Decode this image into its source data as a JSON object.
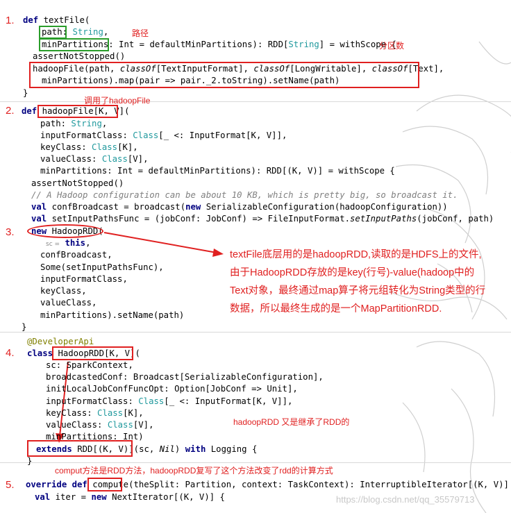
{
  "colors": {
    "red": "#e02020",
    "green": "#2a9d2a",
    "keyword": "#000080",
    "type": "#20999d",
    "comment": "#808080",
    "annotation": "#808000"
  },
  "numbers": [
    "1.",
    "2.",
    "3.",
    "4.",
    "5."
  ],
  "notes": {
    "path_label": "路径",
    "partition_label": "分区数",
    "calls_hadoopfile": "调用了hadoopFile",
    "explanation": [
      "textFile底层用的是hadoopRDD,读取的是HDFS上的文件,",
      "由于HadoopRDD存放的是key(行号)-value(hadoop中的",
      "Text对象，最终通过map算子将元组转化为String类型的行",
      "数据，所以最终生成的是一个MapPartitionRDD."
    ],
    "inherits": "hadoopRDD 又是继承了RDD的",
    "compute_note": "comput方法是RDD方法，hadoopRDD复写了这个方法改变了rdd的计算方式"
  },
  "code": {
    "s1": {
      "def": "def",
      "fn": "textFile(",
      "p_path": "path:",
      "t_string": "String",
      "p_minp": "minPartitions:",
      "l2rest_a": " Int = defaultMinPartitions): RDD[",
      "t_string2": "String",
      "l2rest_b": "] = withScope {",
      "l3": "assertNotStopped()",
      "l4a": "hadoopFile(path, ",
      "l4co": "classOf",
      "l4b": "[TextInputFormat], ",
      "l4co2": "classOf",
      "l4c": "[LongWritable], ",
      "l4co3": "classOf",
      "l4d": "[Text],",
      "l5": "minPartitions).map(pair => pair._2.toString).setName(path)",
      "close": "}"
    },
    "s2": {
      "def": "def",
      "sig": "hadoopFile[K, V]",
      "paren": "(",
      "l1a": "path: ",
      "l1t": "String",
      "l1b": ",",
      "l2a": "inputFormatClass: ",
      "l2t": "Class",
      "l2b": "[_ <: InputFormat[K, V]],",
      "l3a": "keyClass: ",
      "l3t": "Class",
      "l3b": "[K],",
      "l4a": "valueClass: ",
      "l4t": "Class",
      "l4b": "[V],",
      "l5": "minPartitions: Int = defaultMinPartitions): RDD[(K, V)] = withScope {",
      "l6": "assertNotStopped()",
      "comment": "// A Hadoop configuration can be about 10 KB, which is pretty big, so broadcast it.",
      "l8kw": "val",
      "l8a": " confBroadcast = broadcast(",
      "l8kw2": "new",
      "l8b": " SerializableConfiguration(hadoopConfiguration))",
      "l9kw": "val",
      "l9a": " setInputPathsFunc = (jobConf: JobConf) => FileInputFormat.",
      "l9it": "setInputPaths",
      "l9b": "(jobConf, path)",
      "l10kw": "new",
      "l10a": " HadoopRDD(",
      "l11sc": "sc =",
      "l11kw": "this",
      "l12": "confBroadcast,",
      "l13": "Some(setInputPathsFunc),",
      "l14": "inputFormatClass,",
      "l15": "keyClass,",
      "l16": "valueClass,",
      "l17": "minPartitions).setName(path)",
      "close": "}"
    },
    "s4": {
      "ann": "@DeveloperApi",
      "kw": "class",
      "sig": "HadoopRDD[K, V]",
      "paren": "(",
      "l1": "sc: SparkContext,",
      "l2": "broadcastedConf: Broadcast[SerializableConfiguration],",
      "l3": "initLocalJobConfFuncOpt: Option[JobConf => Unit],",
      "l4a": "inputFormatClass: ",
      "l4t": "Class",
      "l4b": "[_ <: InputFormat[K, V]],",
      "l5a": "keyClass: ",
      "l5t": "Class",
      "l5b": "[K],",
      "l6a": "valueClass: ",
      "l6t": "Class",
      "l6b": "[V],",
      "l7": "minPartitions: Int)",
      "ext_kw": "extends",
      "ext_a": " RDD[(K, V)]",
      "ext_b": "(sc, ",
      "ext_nil": "Nil",
      "ext_c": ") ",
      "ext_kw2": "with",
      "ext_d": " Logging {",
      "close": "}"
    },
    "s5": {
      "kw": "override def",
      "fn": "compute",
      "rest": "(theSplit: Partition, context: TaskContext): InterruptibleIterator[(K, V)] = {",
      "l2kw": "val",
      "l2a": " iter = ",
      "l2kw2": "new",
      "l2b": " NextIterator[(K, V)] {"
    }
  },
  "watermark": "https://blog.csdn.net/qq_35579713"
}
